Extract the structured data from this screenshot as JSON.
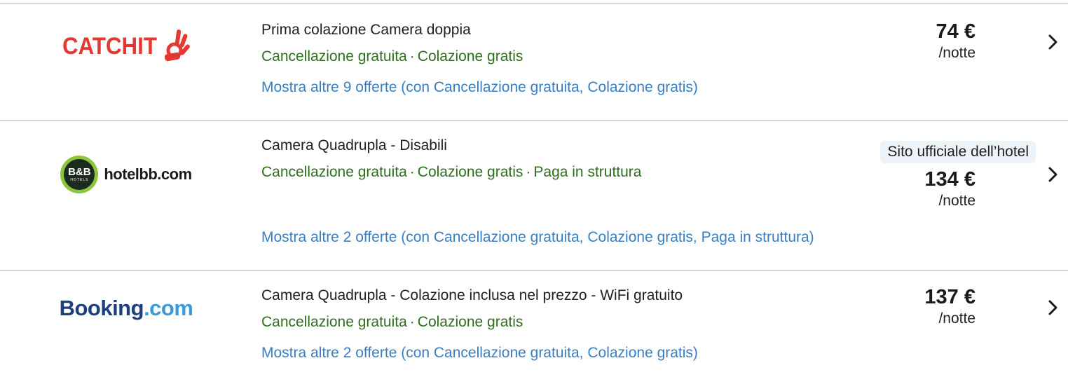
{
  "offers": [
    {
      "provider": "CATCHIT",
      "room": "Prima colazione Camera doppia",
      "features": [
        "Cancellazione gratuita",
        "Colazione gratis"
      ],
      "more_offers": "Mostra altre 9 offerte (con Cancellazione gratuita, Colazione gratis)",
      "badge": "",
      "price": "74 €",
      "per_night": "/notte",
      "logo_color": "#e23a32"
    },
    {
      "provider": "hotelbb.com",
      "logo_mark": "B&B",
      "logo_sub": "HOTELS",
      "room": "Camera Quadrupla - Disabili",
      "features": [
        "Cancellazione gratuita",
        "Colazione gratis",
        "Paga in struttura"
      ],
      "more_offers": "Mostra altre 2 offerte (con Cancellazione gratuita, Colazione gratis, Paga in struttura)",
      "badge": "Sito ufficiale dell’hotel",
      "price": "134 €",
      "per_night": "/notte",
      "logo_color": "#8cc63f"
    },
    {
      "provider_main": "Booking",
      "provider_tld": ".com",
      "room": "Camera Quadrupla - Colazione inclusa nel prezzo - WiFi gratuito",
      "features": [
        "Cancellazione gratuita",
        "Colazione gratis"
      ],
      "more_offers": "Mostra altre 2 offerte (con Cancellazione gratuita, Colazione gratis)",
      "badge": "",
      "price": "137 €",
      "per_night": "/notte",
      "logo_color": "#1d3f7d"
    }
  ],
  "feature_separator": "·",
  "icons": {
    "chevron": "chevron-right-icon"
  },
  "colors": {
    "feature_text": "#2f6e1f",
    "link_text": "#3a7ec2",
    "badge_bg": "#eef3f8",
    "divider": "#d6d6d6"
  }
}
